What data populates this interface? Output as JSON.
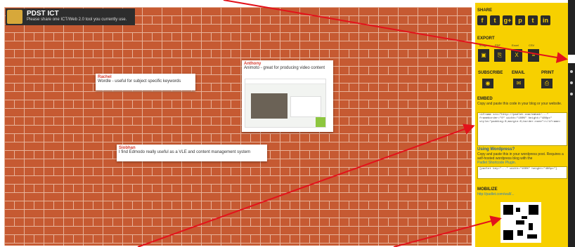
{
  "header": {
    "title": "PDST ICT",
    "subtitle": "Please share one ICT/Web 2.0 tool you currently use."
  },
  "notes": [
    {
      "author": "Rachel",
      "text": "Wordle - useful for subject specific keywords"
    },
    {
      "author": "Anthony",
      "text": "Animoto - great for producing video content"
    },
    {
      "author": "Siobhan",
      "text": "I find Edmodo really useful as a VLE and content management system"
    }
  ],
  "panel": {
    "share_title": "SHARE",
    "share_icons": [
      "f",
      "t",
      "g+",
      "p",
      "t",
      "in"
    ],
    "export_title": "EXPORT",
    "export_labels": [
      "Image",
      "PDF",
      "Excel",
      "CSV"
    ],
    "subscribe_label": "SUBSCRIBE",
    "email_label": "EMAIL",
    "print_label": "PRINT",
    "embed_title": "EMBED",
    "embed_desc": "Copy and paste this code in your blog or your website.",
    "embed_code": "<iframe src=\"http://padlet.com/embed/...\" frameborder=\"0\" width=\"100%\" height=\"480px\" style=\"padding:0;margin:0;border:none\"></iframe>",
    "wordpress_title": "Using Wordpress?",
    "wordpress_desc": "Copy and paste this in your wordpress post. Requires a self-hosted wordpress blog with the",
    "wordpress_plugin": "Padlet Shortcode Plugin.",
    "wordpress_code": "[padlet key=\"...\" width=\"100%\" height=\"480px\"]",
    "mobilize_title": "MOBILIZE",
    "mobilize_link": "http://padlet.com/wall/..."
  },
  "colors": {
    "panel": "#f7d000",
    "wall": "#c65a32",
    "accent": "#d43b2e"
  }
}
